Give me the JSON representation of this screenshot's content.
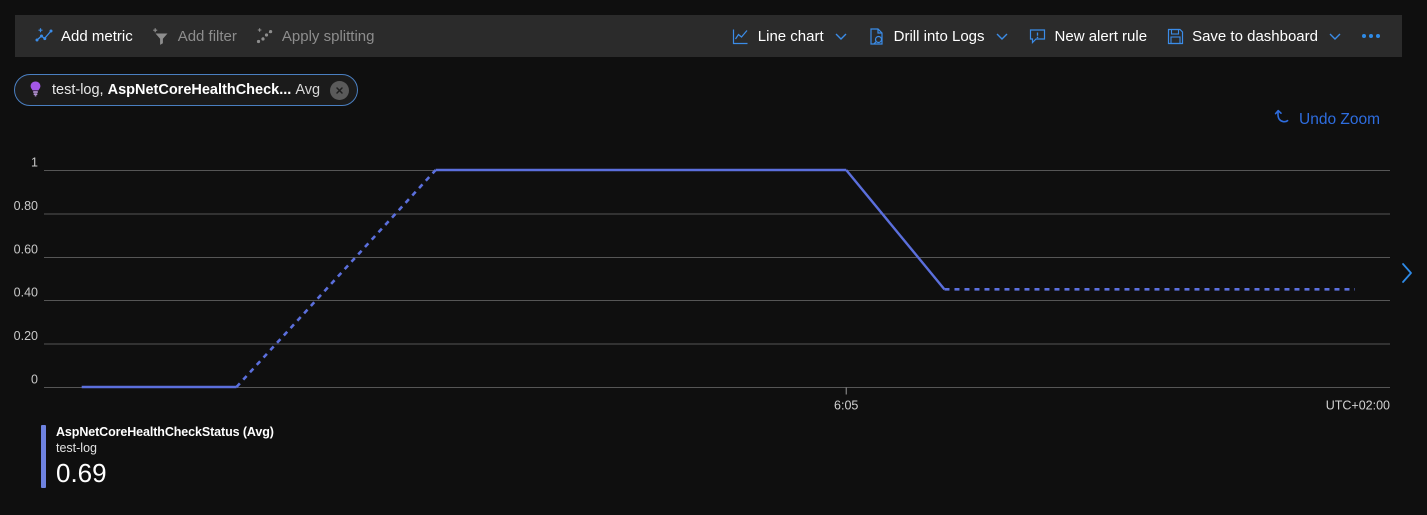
{
  "toolbar": {
    "left_actions": [
      {
        "label": "Add metric",
        "icon": "add-metric-icon",
        "disabled": false
      },
      {
        "label": "Add filter",
        "icon": "add-filter-icon",
        "disabled": true
      },
      {
        "label": "Apply splitting",
        "icon": "apply-splitting-icon",
        "disabled": true
      }
    ],
    "right_actions": [
      {
        "label": "Line chart",
        "icon": "line-chart-icon",
        "caret": true
      },
      {
        "label": "Drill into Logs",
        "icon": "drill-into-logs-icon",
        "caret": true
      },
      {
        "label": "New alert rule",
        "icon": "new-alert-rule-icon",
        "caret": false
      },
      {
        "label": "Save to dashboard",
        "icon": "save-to-dashboard-icon",
        "caret": true
      }
    ],
    "overflow_label": "More commands"
  },
  "metric_chip": {
    "icon": "lightbulb-icon",
    "resource": "test-log,",
    "metric": "AspNetCoreHealthCheck...",
    "aggregation": "Avg",
    "close_label": "Remove metric"
  },
  "undo_zoom": {
    "label": "Undo Zoom",
    "icon": "undo-icon"
  },
  "expand_panel": {
    "icon": "chevron-right-icon"
  },
  "legend": {
    "title": "AspNetCoreHealthCheckStatus (Avg)",
    "subtitle": "test-log",
    "value": "0.69",
    "color": "#6e82e0"
  },
  "colors": {
    "page_background": "#0f0f0f",
    "toolbar_background": "#2b2b2b",
    "accent_blue": "#2e8ae6",
    "link_blue": "#2e6ddf",
    "series_blue": "#5b6fdc",
    "gridline": "#565656",
    "chip_border": "#4a7fc1",
    "lightbulb_purple": "#a457e8",
    "disabled_text": "#8d8d8d"
  },
  "chart_data": {
    "type": "line",
    "title": "AspNetCoreHealthCheckStatus (Avg)",
    "xlabel": "",
    "ylabel": "",
    "ylim": [
      0,
      1
    ],
    "yticks": [
      "0",
      "0.20",
      "0.40",
      "0.60",
      "0.80",
      "1"
    ],
    "ytick_values": [
      0,
      0.2,
      0.4,
      0.6,
      0.8,
      1
    ],
    "xticks": [
      "6:05"
    ],
    "xtick_positions": [
      0.596
    ],
    "timezone_label": "UTC+02:00",
    "grid": true,
    "legend_position": "bottom-left",
    "series": [
      {
        "name": "AspNetCoreHealthCheckStatus (Avg)",
        "resource": "test-log",
        "color": "#5b6fdc",
        "current_value": 0.69,
        "segments": [
          {
            "style": "solid",
            "points": [
              [
                0.028,
                0.0
              ],
              [
                0.143,
                0.0
              ]
            ]
          },
          {
            "style": "dotted",
            "points": [
              [
                0.143,
                0.0
              ],
              [
                0.291,
                1.0
              ]
            ]
          },
          {
            "style": "solid",
            "points": [
              [
                0.291,
                1.0
              ],
              [
                0.596,
                1.0
              ]
            ]
          },
          {
            "style": "solid",
            "points": [
              [
                0.596,
                1.0
              ],
              [
                0.669,
                0.45
              ]
            ]
          },
          {
            "style": "dotted",
            "points": [
              [
                0.669,
                0.45
              ],
              [
                0.974,
                0.45
              ]
            ]
          }
        ]
      }
    ]
  }
}
